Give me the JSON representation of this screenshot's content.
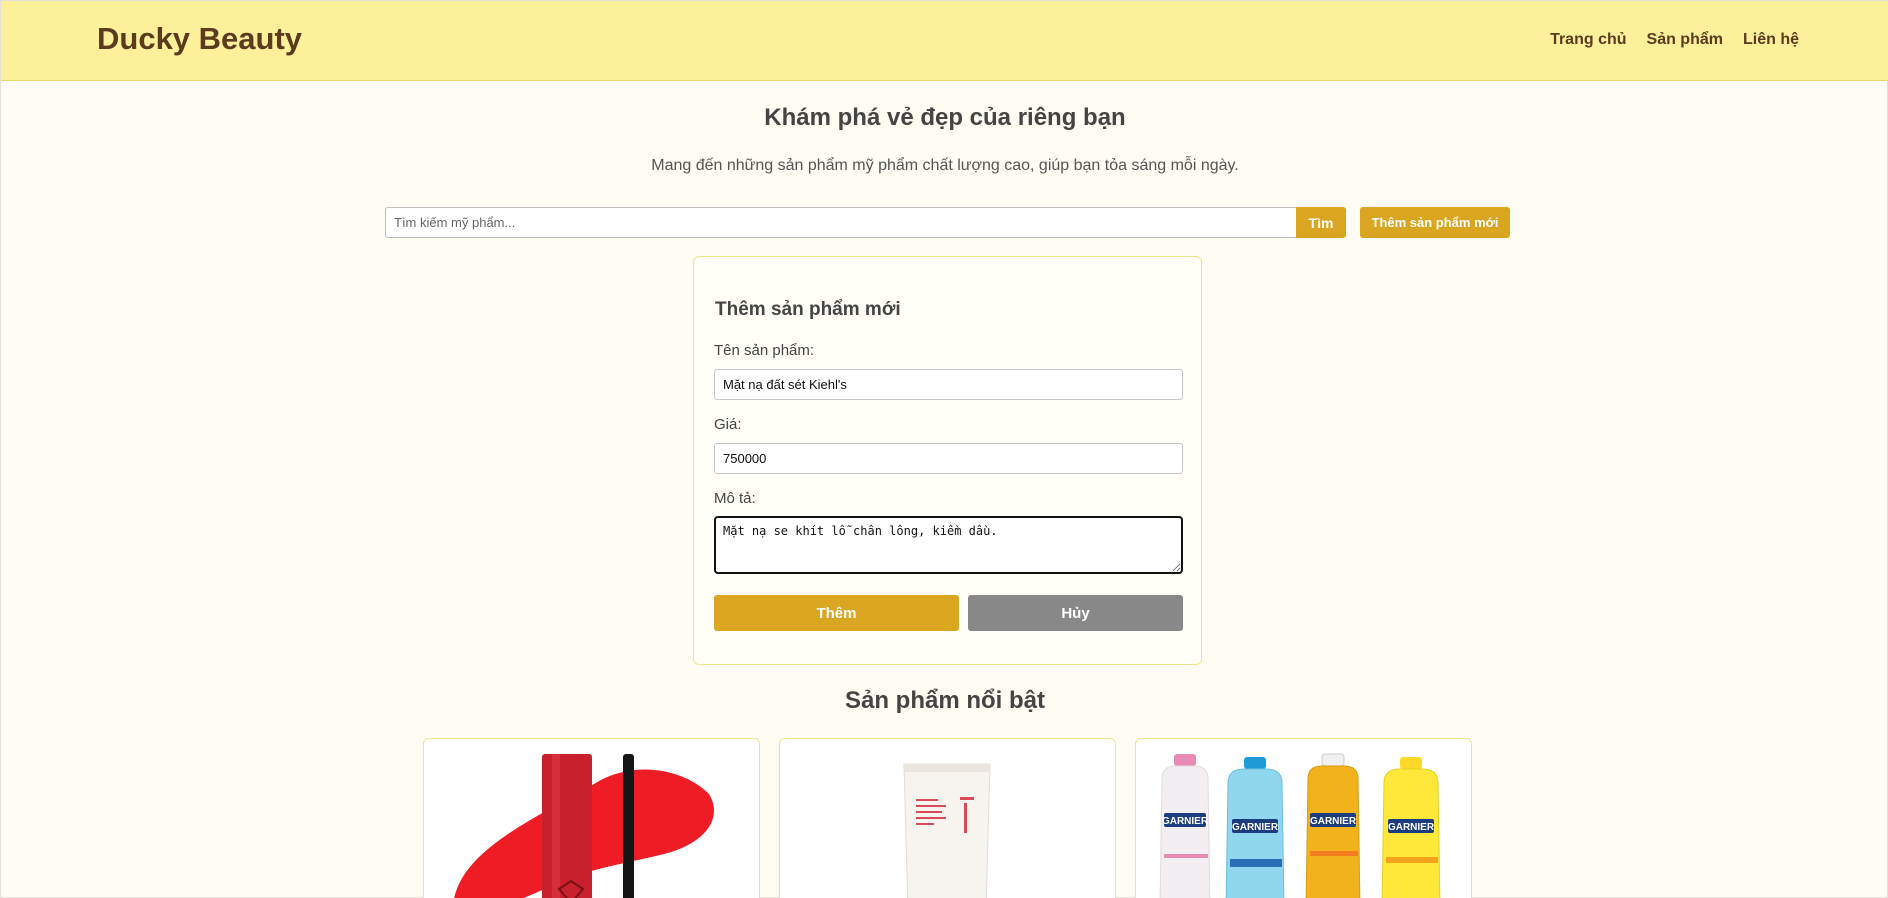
{
  "header": {
    "logo": "Ducky Beauty",
    "nav": [
      "Trang chủ",
      "Sản phẩm",
      "Liên hệ"
    ]
  },
  "hero": {
    "title": "Khám phá vẻ đẹp của riêng bạn",
    "subtitle": "Mang đến những sản phẩm mỹ phẩm chất lượng cao, giúp bạn tỏa sáng mỗi ngày."
  },
  "search": {
    "placeholder": "Tìm kiếm mỹ phẩm...",
    "value": "",
    "button_label": "Tìm",
    "add_button_label": "Thêm sản phẩm mới"
  },
  "form": {
    "title": "Thêm sản phẩm mới",
    "name_label": "Tên sản phẩm:",
    "name_value": "Mặt nạ đất sét Kiehl's",
    "price_label": "Giá:",
    "price_value": "750000",
    "desc_label": "Mô tả:",
    "desc_value": "Mặt nạ se khít lỗ chân lông, kiềm dầu.",
    "submit_label": "Thêm",
    "cancel_label": "Hủy"
  },
  "featured": {
    "title": "Sản phẩm nổi bật",
    "products": [
      {
        "image": "red-lip-tint-product-image"
      },
      {
        "image": "innisfree-sunscreen-tube-image"
      },
      {
        "image": "garnier-micellar-water-bottles-image",
        "bottle_labels": [
          "GARNIER",
          "GARNIER",
          "GARNIER",
          "GARNIER"
        ]
      }
    ]
  },
  "colors": {
    "header_bg": "#fdf09a",
    "accent": "#daa520",
    "cancel": "#888888",
    "page_bg": "#fefcf3",
    "logo": "#5b3a1e"
  }
}
